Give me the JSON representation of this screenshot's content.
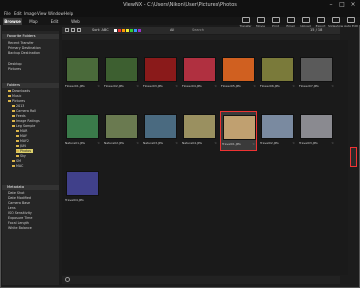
{
  "title": "ViewNX - C:\\Users\\Nikon\\User\\Pictures\\Photos",
  "menu": [
    "File",
    "Edit",
    "Image",
    "View",
    "Window",
    "Help"
  ],
  "tabs": [
    "Browse",
    "Map",
    "Edit",
    "Web"
  ],
  "toolbar_buttons": [
    "Transfer",
    "Movie",
    "Print",
    "Email",
    "Upload",
    "Export",
    "Slideshow",
    "Auto Edit"
  ],
  "sort_label": "Sort: ABC",
  "all_label": "All",
  "search_label": "Search",
  "page_info": "15 / 18",
  "panels": {
    "favorites": {
      "title": "Favorite Folders",
      "items": [
        "Recent Transfer",
        "Primary Destination",
        "Backup Destination",
        "",
        "Desktop",
        "Pictures"
      ]
    },
    "folders": {
      "title": "Folders",
      "items": [
        "Downloads",
        "Music",
        "Pictures",
        "2013",
        "Camera Roll",
        "Feeds",
        "Image Ratings",
        "Leg Sample",
        "MAR",
        "MAY",
        "MAY2",
        "JUN",
        "Photos",
        "Sky",
        "SM",
        "MAC"
      ]
    },
    "metadata": {
      "title": "Metadata",
      "items": [
        "Date Shot",
        "Date Modified",
        "Camera Base",
        "Lens",
        "ISO Sensitivity",
        "Exposure Time",
        "Focal Length",
        "White Balance"
      ]
    }
  },
  "thumbnails": [
    {
      "name": "Flower01.JPG",
      "rating": "☆",
      "color": "#4a6a3a"
    },
    {
      "name": "Flower02.JPG",
      "rating": "☆",
      "color": "#3d5f30"
    },
    {
      "name": "Flower03.JPG",
      "rating": "☆",
      "color": "#8a1a1a"
    },
    {
      "name": "Flower04.JPG",
      "rating": "☆",
      "color": "#b03040"
    },
    {
      "name": "Flower05.JPG",
      "rating": "☆",
      "color": "#d06020"
    },
    {
      "name": "Flower06.JPG",
      "rating": "☆",
      "color": "#7a7a3a"
    },
    {
      "name": "Flower07.JPG",
      "rating": "☆",
      "color": "#5a5a5a"
    },
    {
      "name": "Nature01.JPG",
      "rating": "☆",
      "color": "#3a7a4a"
    },
    {
      "name": "Nature02.JPG",
      "rating": "☆",
      "color": "#6a7a50"
    },
    {
      "name": "Nature03.JPG",
      "rating": "☆",
      "color": "#4a6a80"
    },
    {
      "name": "Nature04.JPG",
      "rating": "☆",
      "color": "#9a9060"
    },
    {
      "name": "Travel01.JPG",
      "rating": "☆",
      "color": "#c0a070"
    },
    {
      "name": "Travel02.JPG",
      "rating": "☆",
      "color": "#7a8aa0"
    },
    {
      "name": "Travel03.JPG",
      "rating": "☆",
      "color": "#8a8a90"
    },
    {
      "name": "Travel04.JPG",
      "rating": "",
      "color": "#40408a"
    }
  ],
  "selected_index": 11
}
